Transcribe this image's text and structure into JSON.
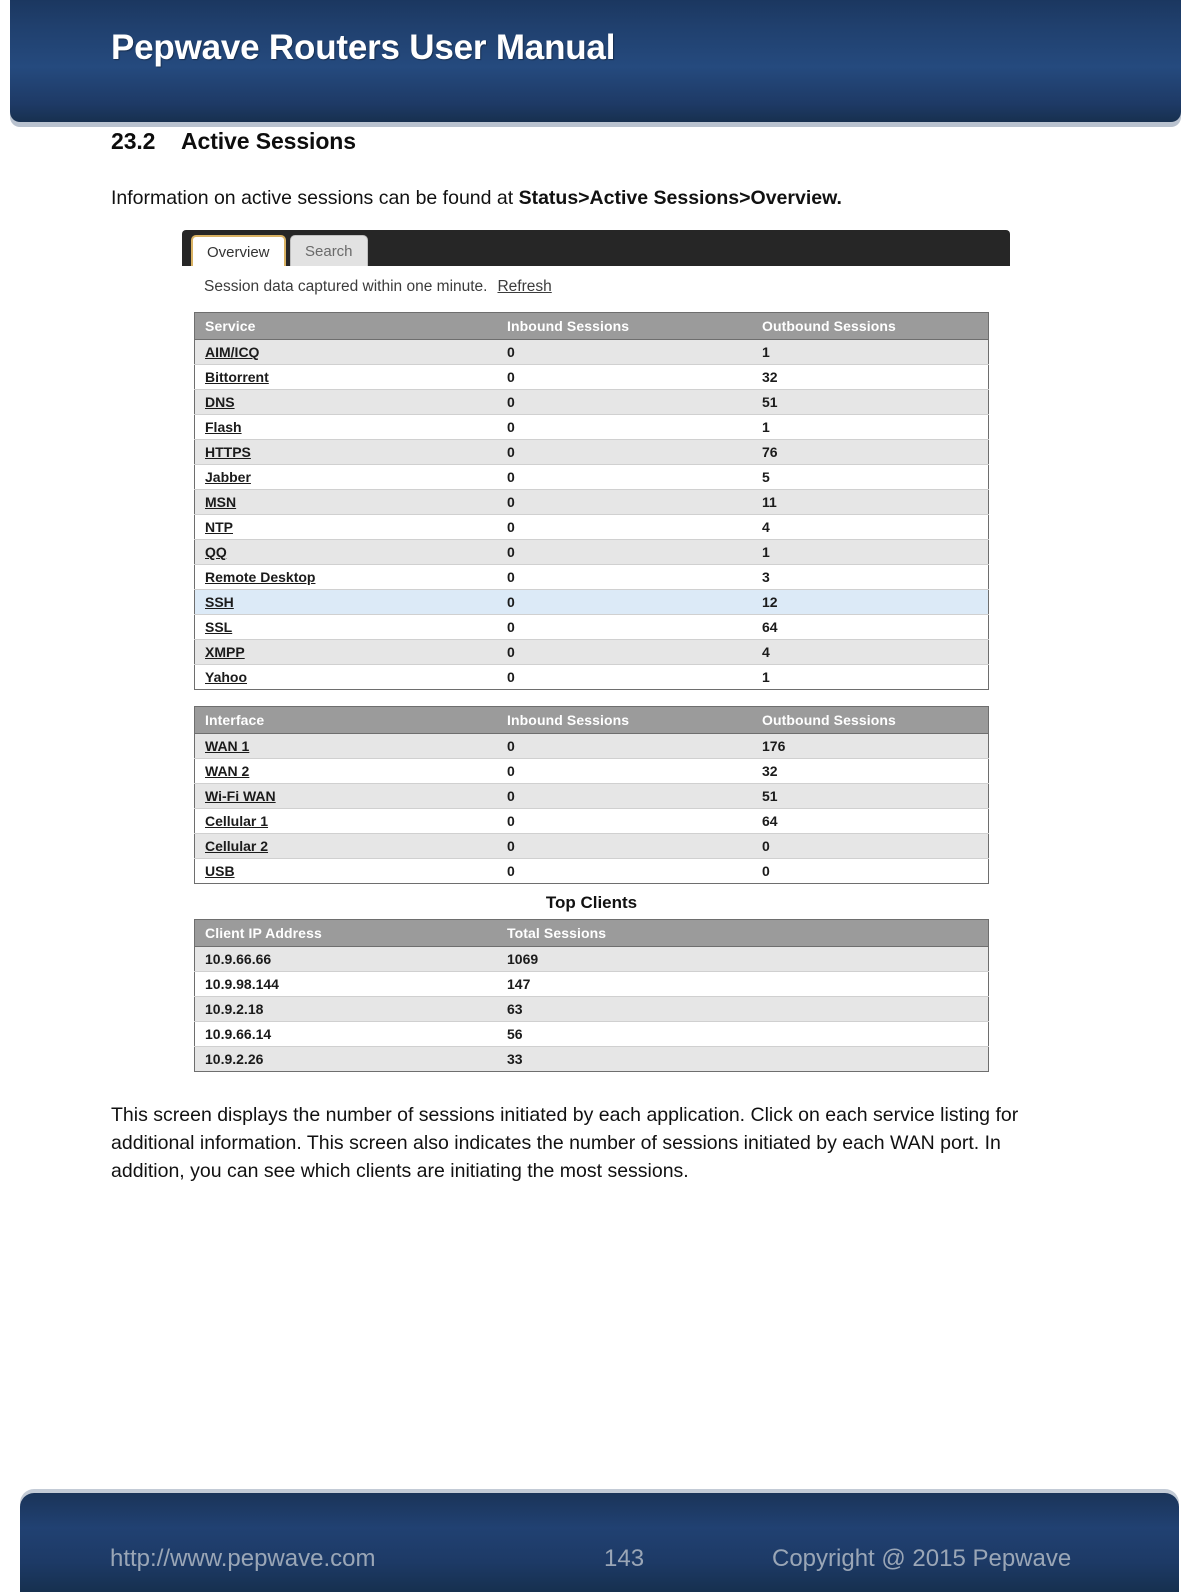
{
  "header": {
    "title": "Pepwave Routers User Manual"
  },
  "section": {
    "number": "23.2",
    "title": "Active Sessions",
    "intro_prefix": "Information on active sessions can be found at ",
    "intro_path": "Status>Active Sessions>Overview."
  },
  "screenshot": {
    "tabs": [
      {
        "label": "Overview",
        "active": true
      },
      {
        "label": "Search",
        "active": false
      }
    ],
    "capture_note": "Session data captured within one minute.",
    "refresh_label": "Refresh",
    "service_table": {
      "columns": [
        "Service",
        "Inbound Sessions",
        "Outbound Sessions"
      ],
      "rows": [
        [
          "AIM/ICQ",
          "0",
          "1"
        ],
        [
          "Bittorrent",
          "0",
          "32"
        ],
        [
          "DNS",
          "0",
          "51"
        ],
        [
          "Flash",
          "0",
          "1"
        ],
        [
          "HTTPS",
          "0",
          "76"
        ],
        [
          "Jabber",
          "0",
          "5"
        ],
        [
          "MSN",
          "0",
          "11"
        ],
        [
          "NTP",
          "0",
          "4"
        ],
        [
          "QQ",
          "0",
          "1"
        ],
        [
          "Remote Desktop",
          "0",
          "3"
        ],
        [
          "SSH",
          "0",
          "12"
        ],
        [
          "SSL",
          "0",
          "64"
        ],
        [
          "XMPP",
          "0",
          "4"
        ],
        [
          "Yahoo",
          "0",
          "1"
        ]
      ],
      "highlighted_row_index": 10
    },
    "interface_table": {
      "columns": [
        "Interface",
        "Inbound Sessions",
        "Outbound Sessions"
      ],
      "rows": [
        [
          "WAN 1",
          "0",
          "176"
        ],
        [
          "WAN 2",
          "0",
          "32"
        ],
        [
          "Wi-Fi WAN",
          "0",
          "51"
        ],
        [
          "Cellular 1",
          "0",
          "64"
        ],
        [
          "Cellular 2",
          "0",
          "0"
        ],
        [
          "USB",
          "0",
          "0"
        ]
      ]
    },
    "top_clients": {
      "title": "Top Clients",
      "columns": [
        "Client IP Address",
        "Total Sessions"
      ],
      "rows": [
        [
          "10.9.66.66",
          "1069"
        ],
        [
          "10.9.98.144",
          "147"
        ],
        [
          "10.9.2.18",
          "63"
        ],
        [
          "10.9.66.14",
          "56"
        ],
        [
          "10.9.2.26",
          "33"
        ]
      ]
    }
  },
  "description": "This screen displays the number of sessions initiated by each application. Click on each service listing for additional information. This screen also indicates the number of sessions initiated by each WAN port. In addition, you can see which clients are initiating the most sessions.",
  "footer": {
    "url": "http://www.pepwave.com",
    "page_number": "143",
    "copyright": "Copyright @ 2015 Pepwave"
  },
  "colors": {
    "brand_navy": "#1e3a66",
    "tab_active_border": "#d9b263",
    "table_header_gray": "#9b9b9b",
    "row_highlight_blue": "#dceaf7"
  }
}
